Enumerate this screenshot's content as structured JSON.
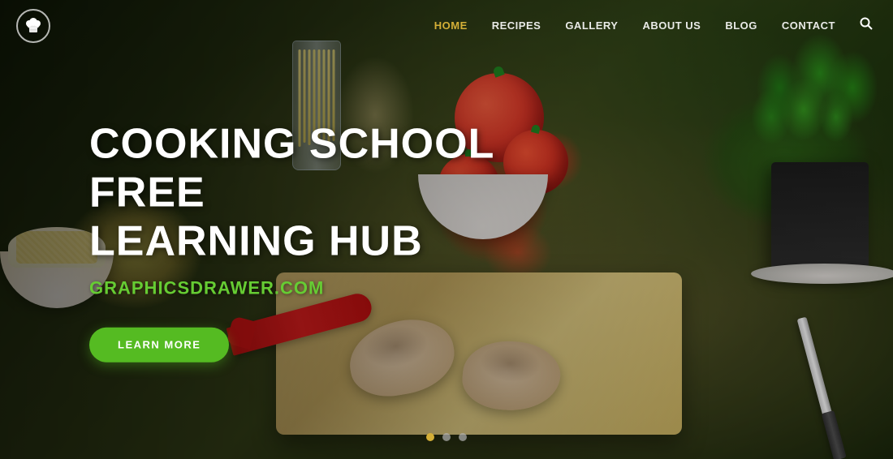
{
  "navbar": {
    "logo_icon": "🍳",
    "links": [
      {
        "label": "HOME",
        "active": true
      },
      {
        "label": "RECIPES",
        "active": false
      },
      {
        "label": "GALLERY",
        "active": false
      },
      {
        "label": "ABOUT US",
        "active": false
      },
      {
        "label": "BLOG",
        "active": false
      },
      {
        "label": "CONTACT",
        "active": false
      }
    ],
    "search_icon": "🔍"
  },
  "hero": {
    "title_line1": "COOKING SCHOOL FREE",
    "title_line2": "LEARNING HUB",
    "subtitle": "GRAPHICSDRAWER.COM",
    "cta_label": "LEARN MORE"
  },
  "slider": {
    "dots": [
      {
        "active": true
      },
      {
        "active": false
      },
      {
        "active": false
      }
    ]
  },
  "colors": {
    "accent_gold": "#d4af37",
    "accent_green": "#55bb22",
    "subtitle_green": "#66cc33",
    "nav_active": "#d4af37"
  }
}
